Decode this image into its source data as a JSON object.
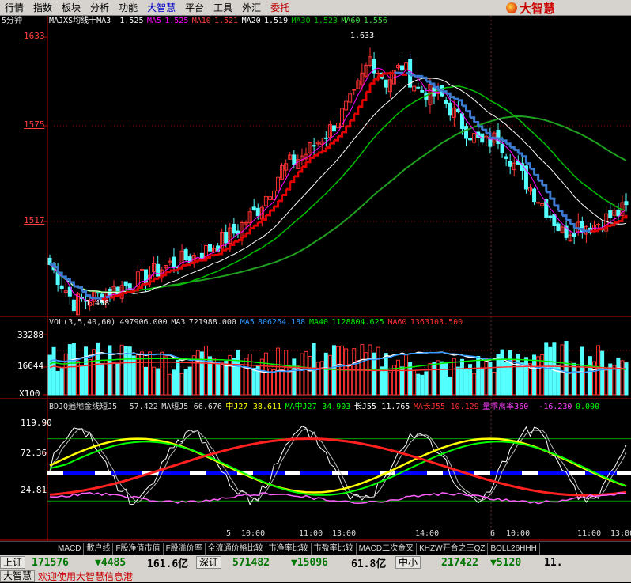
{
  "menu": [
    "行情",
    "指数",
    "板块",
    "分析",
    "功能",
    "大智慧",
    "平台",
    "工具",
    "外汇",
    "委托"
  ],
  "logo_text": "大智慧",
  "period": "5分钟",
  "main_legend": [
    {
      "text": "MAJXS均线十MA3",
      "color": "#ffffff"
    },
    {
      "text": "1.525",
      "color": "#ffffff"
    },
    {
      "text": "MA5",
      "color": "#ff00ff"
    },
    {
      "text": "1.525",
      "color": "#ff00ff"
    },
    {
      "text": "MA10",
      "color": "#ff4040"
    },
    {
      "text": "1.521",
      "color": "#ff4040"
    },
    {
      "text": "MA20",
      "color": "#ffffff"
    },
    {
      "text": "1.519",
      "color": "#ffffff"
    },
    {
      "text": "MA30",
      "color": "#00c000"
    },
    {
      "text": "1.523",
      "color": "#00c000"
    },
    {
      "text": "MA60",
      "color": "#40e040"
    },
    {
      "text": "1.556",
      "color": "#40e040"
    }
  ],
  "price_axis": [
    "1633",
    "1575",
    "1517"
  ],
  "high_label": "1.633",
  "low_label": "1.458",
  "vol_legend": [
    {
      "text": "VOL(3,5,40,60)",
      "color": "#dddddd"
    },
    {
      "text": "497906.000",
      "color": "#dddddd"
    },
    {
      "text": "MA3",
      "color": "#dddddd"
    },
    {
      "text": "721988.000",
      "color": "#dddddd"
    },
    {
      "text": "MA5",
      "color": "#3399ff"
    },
    {
      "text": "806264.188",
      "color": "#3399ff"
    },
    {
      "text": "MA40",
      "color": "#00ee00"
    },
    {
      "text": "1128804.625",
      "color": "#00ee00"
    },
    {
      "text": "MA60",
      "color": "#ff3030"
    },
    {
      "text": "1363103.500",
      "color": "#ff3030"
    }
  ],
  "vol_axis": [
    "33288",
    "16644",
    "X100"
  ],
  "ind_legend": [
    {
      "text": "BDJQ遍地金线短J5",
      "color": "#dddddd"
    },
    {
      "text": "57.422",
      "color": "#dddddd"
    },
    {
      "text": "MA短J5",
      "color": "#dddddd"
    },
    {
      "text": "66.676",
      "color": "#dddddd"
    },
    {
      "text": "中J27",
      "color": "#ffff00"
    },
    {
      "text": "38.611",
      "color": "#ffff00"
    },
    {
      "text": "MA中J27",
      "color": "#00ff00"
    },
    {
      "text": "34.903",
      "color": "#00ff00"
    },
    {
      "text": "长J55",
      "color": "#ffffff"
    },
    {
      "text": "11.765",
      "color": "#ffffff"
    },
    {
      "text": "MA长J55",
      "color": "#ff3030"
    },
    {
      "text": "10.129",
      "color": "#ff3030"
    },
    {
      "text": "量乖离率360",
      "color": "#ff40ff"
    },
    {
      "text": "-16.230",
      "color": "#ff40ff"
    },
    {
      "text": "0.000",
      "color": "#00ff00"
    }
  ],
  "ind_axis": [
    "119.90",
    "72.36",
    "24.81"
  ],
  "time_labels": [
    {
      "t": "5",
      "c": "#dddddd"
    },
    {
      "t": "10:00",
      "c": "#dddddd"
    },
    {
      "t": "11:00",
      "c": "#dddddd"
    },
    {
      "t": "13:00",
      "c": "#dddddd"
    },
    {
      "t": "14:00",
      "c": "#dddddd"
    },
    {
      "t": "6",
      "c": "#dddddd"
    },
    {
      "t": "10:00",
      "c": "#dddddd"
    },
    {
      "t": "11:00",
      "c": "#dddddd"
    },
    {
      "t": "13:00",
      "c": "#dddddd"
    }
  ],
  "bottom_tabs": [
    "MACD",
    "散户线",
    "F股净值市值",
    "F股溢价率",
    "全流通价格比较",
    "市净率比较",
    "市盈率比较",
    "MACD二次金叉",
    "KHZW开合之王QZ",
    "BOLL26HHH"
  ],
  "status": {
    "sh_label": "上证",
    "sh_value": "171576",
    "sh_change": "▼4485",
    "sh_amount": "161.6亿",
    "sz_label": "深证",
    "sz_value": "571482",
    "sz_change": "▼15096",
    "sz_amount": "61.8亿",
    "zx_label": "中小",
    "zx_value": "217422",
    "zx_change": "▼5120",
    "zx_amount": "11."
  },
  "ticker": {
    "brand": "大智慧",
    "message": "欢迎使用大智慧信息港"
  },
  "colors": {
    "up": "#ff3232",
    "down": "#54ffff",
    "ma_blue": "#3a7ad0",
    "ma_red": "#e00000",
    "grid": "#c00000"
  }
}
